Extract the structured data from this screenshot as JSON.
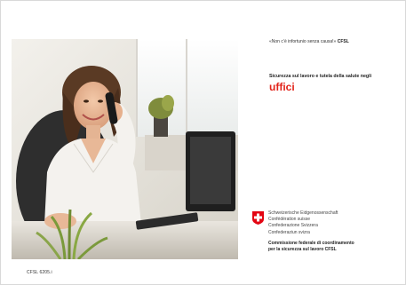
{
  "tagline": {
    "quote": "«Non c’è infortunio senza causa!»",
    "brand": "CFSL"
  },
  "title": {
    "subtitle": "Sicurezza sul lavoro e tutela della salute negli",
    "main": "uffici"
  },
  "confederation": {
    "lines": [
      "Schweizerische Eidgenossenschaft",
      "Confédération suisse",
      "Confederazione Svizzera",
      "Confederaziun svizra"
    ],
    "commission_line1": "Commissione federale di coordinamento",
    "commission_line2": "per la sicurezza sul lavoro CFSL"
  },
  "doc_code": "CFSL 6205.i",
  "colors": {
    "accent_red": "#e2231a",
    "swiss_red": "#e30613"
  },
  "illustration": {
    "subject": "office-worker-on-phone-photo"
  }
}
